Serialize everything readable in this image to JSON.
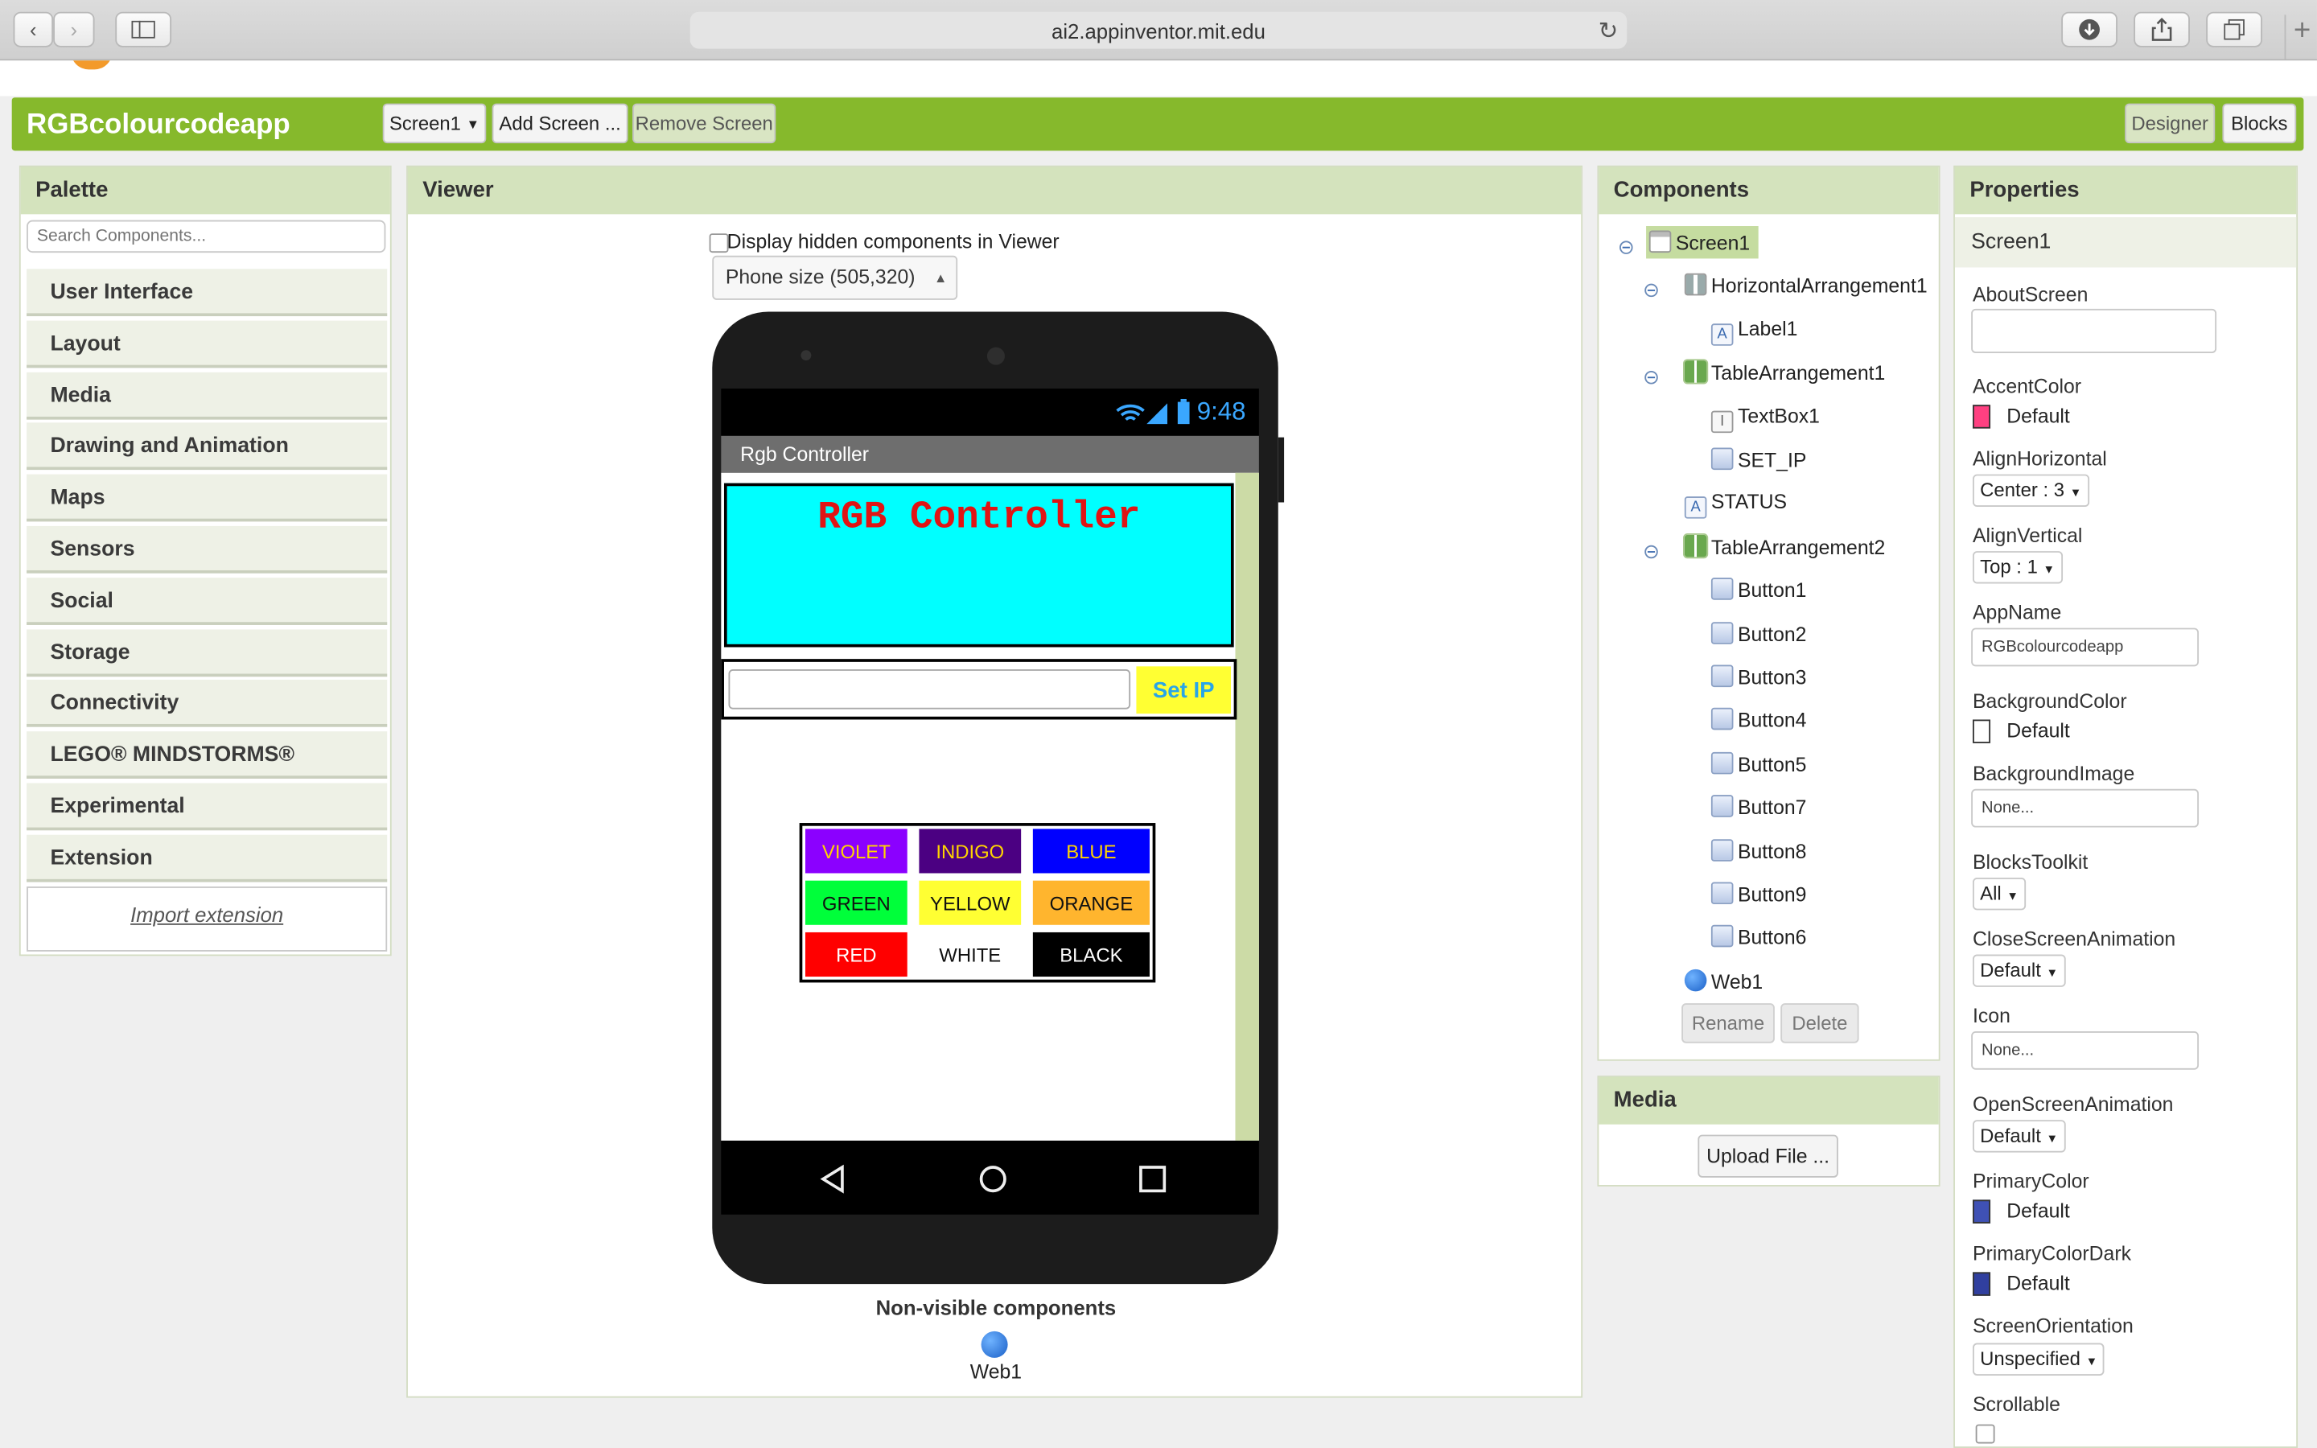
{
  "browser": {
    "url": "ai2.appinventor.mit.edu"
  },
  "header": {
    "app_name": "RGBcolourcodeapp",
    "screen_select": "Screen1",
    "add_screen": "Add Screen ...",
    "remove_screen": "Remove Screen",
    "designer": "Designer",
    "blocks": "Blocks"
  },
  "palette": {
    "title": "Palette",
    "search_placeholder": "Search Components...",
    "categories": [
      "User Interface",
      "Layout",
      "Media",
      "Drawing and Animation",
      "Maps",
      "Sensors",
      "Social",
      "Storage",
      "Connectivity",
      "LEGO® MINDSTORMS®",
      "Experimental",
      "Extension"
    ],
    "import_extension": "Import extension"
  },
  "viewer": {
    "title": "Viewer",
    "hidden_checkbox_label": "Display hidden components in Viewer",
    "phone_size": "Phone size (505,320)",
    "status_time": "9:48",
    "app_title": "Rgb Controller",
    "label_text": "RGB Controller",
    "set_ip_label": "Set IP",
    "buttons": [
      {
        "label": "VIOLET",
        "bg": "#8b00ff",
        "fg": "#ffd400"
      },
      {
        "label": "INDIGO",
        "bg": "#4b0082",
        "fg": "#ffd400"
      },
      {
        "label": "BLUE",
        "bg": "#0000ff",
        "fg": "#ffd400"
      },
      {
        "label": "GREEN",
        "bg": "#00ff3a",
        "fg": "#111111"
      },
      {
        "label": "YELLOW",
        "bg": "#ffff33",
        "fg": "#111111"
      },
      {
        "label": "ORANGE",
        "bg": "#ffb52e",
        "fg": "#111111"
      },
      {
        "label": "RED",
        "bg": "#ff0000",
        "fg": "#ffffff"
      },
      {
        "label": "WHITE",
        "bg": "#ffffff",
        "fg": "#111111"
      },
      {
        "label": "BLACK",
        "bg": "#000000",
        "fg": "#ffffff"
      }
    ],
    "non_visible_title": "Non-visible components",
    "non_visible_item": "Web1"
  },
  "components": {
    "title": "Components",
    "tree": [
      {
        "name": "Screen1",
        "icon": "screen-icon"
      },
      {
        "name": "HorizontalArrangement1",
        "icon": "horizontal-arrangement-icon"
      },
      {
        "name": "Label1",
        "icon": "label-icon"
      },
      {
        "name": "TableArrangement1",
        "icon": "table-arrangement-icon"
      },
      {
        "name": "TextBox1",
        "icon": "textbox-icon"
      },
      {
        "name": "SET_IP",
        "icon": "button-icon"
      },
      {
        "name": "STATUS",
        "icon": "label-icon"
      },
      {
        "name": "TableArrangement2",
        "icon": "table-arrangement-icon"
      },
      {
        "name": "Button1",
        "icon": "button-icon"
      },
      {
        "name": "Button2",
        "icon": "button-icon"
      },
      {
        "name": "Button3",
        "icon": "button-icon"
      },
      {
        "name": "Button4",
        "icon": "button-icon"
      },
      {
        "name": "Button5",
        "icon": "button-icon"
      },
      {
        "name": "Button7",
        "icon": "button-icon"
      },
      {
        "name": "Button8",
        "icon": "button-icon"
      },
      {
        "name": "Button9",
        "icon": "button-icon"
      },
      {
        "name": "Button6",
        "icon": "button-icon"
      },
      {
        "name": "Web1",
        "icon": "web-icon"
      }
    ],
    "rename": "Rename",
    "delete": "Delete"
  },
  "media": {
    "title": "Media",
    "upload": "Upload File ..."
  },
  "properties": {
    "title": "Properties",
    "component": "Screen1",
    "about_screen": "AboutScreen",
    "accent_color": "AccentColor",
    "accent_value": "Default",
    "align_h": "AlignHorizontal",
    "align_h_value": "Center : 3",
    "align_v": "AlignVertical",
    "align_v_value": "Top : 1",
    "app_name": "AppName",
    "app_name_value": "RGBcolourcodeapp",
    "bg_color": "BackgroundColor",
    "bg_color_value": "Default",
    "bg_image": "BackgroundImage",
    "bg_image_value": "None...",
    "blocks_toolkit": "BlocksToolkit",
    "blocks_toolkit_value": "All",
    "close_anim": "CloseScreenAnimation",
    "close_anim_value": "Default",
    "icon": "Icon",
    "icon_value": "None...",
    "open_anim": "OpenScreenAnimation",
    "open_anim_value": "Default",
    "primary_color": "PrimaryColor",
    "primary_color_value": "Default",
    "primary_color_dark": "PrimaryColorDark",
    "primary_color_dark_value": "Default",
    "orientation": "ScreenOrientation",
    "orientation_value": "Unspecified",
    "scrollable": "Scrollable",
    "colors": {
      "accent": "#ff4081",
      "primary": "#3f51b5",
      "primary_dark": "#303f9f",
      "background": "#ffffff"
    }
  }
}
